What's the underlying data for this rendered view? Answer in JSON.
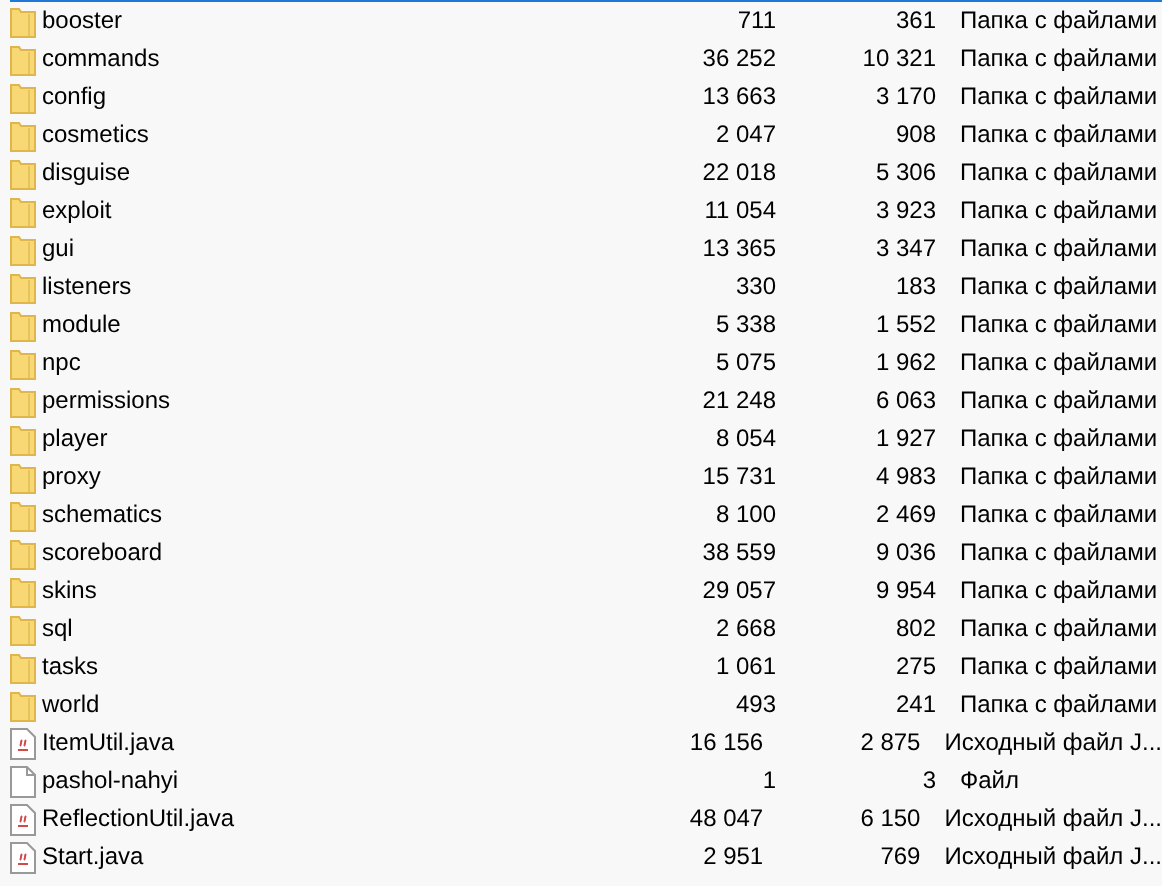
{
  "files": [
    {
      "kind": "folder",
      "name": "booster",
      "size": "711",
      "packed": "361",
      "type": "Папка с файлами"
    },
    {
      "kind": "folder",
      "name": "commands",
      "size": "36 252",
      "packed": "10 321",
      "type": "Папка с файлами"
    },
    {
      "kind": "folder",
      "name": "config",
      "size": "13 663",
      "packed": "3 170",
      "type": "Папка с файлами"
    },
    {
      "kind": "folder",
      "name": "cosmetics",
      "size": "2 047",
      "packed": "908",
      "type": "Папка с файлами"
    },
    {
      "kind": "folder",
      "name": "disguise",
      "size": "22 018",
      "packed": "5 306",
      "type": "Папка с файлами"
    },
    {
      "kind": "folder",
      "name": "exploit",
      "size": "11 054",
      "packed": "3 923",
      "type": "Папка с файлами"
    },
    {
      "kind": "folder",
      "name": "gui",
      "size": "13 365",
      "packed": "3 347",
      "type": "Папка с файлами"
    },
    {
      "kind": "folder",
      "name": "listeners",
      "size": "330",
      "packed": "183",
      "type": "Папка с файлами"
    },
    {
      "kind": "folder",
      "name": "module",
      "size": "5 338",
      "packed": "1 552",
      "type": "Папка с файлами"
    },
    {
      "kind": "folder",
      "name": "npc",
      "size": "5 075",
      "packed": "1 962",
      "type": "Папка с файлами"
    },
    {
      "kind": "folder",
      "name": "permissions",
      "size": "21 248",
      "packed": "6 063",
      "type": "Папка с файлами"
    },
    {
      "kind": "folder",
      "name": "player",
      "size": "8 054",
      "packed": "1 927",
      "type": "Папка с файлами"
    },
    {
      "kind": "folder",
      "name": "proxy",
      "size": "15 731",
      "packed": "4 983",
      "type": "Папка с файлами"
    },
    {
      "kind": "folder",
      "name": "schematics",
      "size": "8 100",
      "packed": "2 469",
      "type": "Папка с файлами"
    },
    {
      "kind": "folder",
      "name": "scoreboard",
      "size": "38 559",
      "packed": "9 036",
      "type": "Папка с файлами"
    },
    {
      "kind": "folder",
      "name": "skins",
      "size": "29 057",
      "packed": "9 954",
      "type": "Папка с файлами"
    },
    {
      "kind": "folder",
      "name": "sql",
      "size": "2 668",
      "packed": "802",
      "type": "Папка с файлами"
    },
    {
      "kind": "folder",
      "name": "tasks",
      "size": "1 061",
      "packed": "275",
      "type": "Папка с файлами"
    },
    {
      "kind": "folder",
      "name": "world",
      "size": "493",
      "packed": "241",
      "type": "Папка с файлами"
    },
    {
      "kind": "java",
      "name": "ItemUtil.java",
      "size": "16 156",
      "packed": "2 875",
      "type": "Исходный файл J..."
    },
    {
      "kind": "file",
      "name": "pashol-nahyi",
      "size": "1",
      "packed": "3",
      "type": "Файл"
    },
    {
      "kind": "java",
      "name": "ReflectionUtil.java",
      "size": "48 047",
      "packed": "6 150",
      "type": "Исходный файл J..."
    },
    {
      "kind": "java",
      "name": "Start.java",
      "size": "2 951",
      "packed": "769",
      "type": "Исходный файл J..."
    }
  ]
}
